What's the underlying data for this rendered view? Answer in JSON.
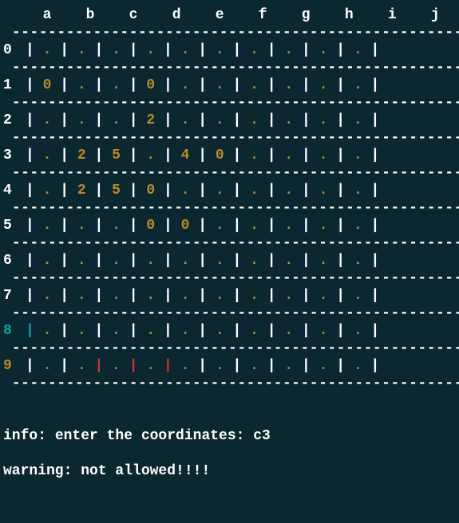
{
  "grid": {
    "col_labels": [
      "a",
      "b",
      "c",
      "d",
      "e",
      "f",
      "g",
      "h",
      "i",
      "j"
    ],
    "row_labels": [
      "0",
      "1",
      "2",
      "3",
      "4",
      "5",
      "6",
      "7",
      "8",
      "9"
    ],
    "cells": [
      [
        ".",
        ".",
        ".",
        ".",
        ".",
        ".",
        ".",
        ".",
        ".",
        "."
      ],
      [
        "0",
        ".",
        ".",
        "0",
        ".",
        ".",
        ".",
        ".",
        ".",
        "."
      ],
      [
        ".",
        ".",
        ".",
        "2",
        ".",
        ".",
        ".",
        ".",
        ".",
        "."
      ],
      [
        ".",
        "2",
        "5",
        ".",
        "4",
        "0",
        ".",
        ".",
        ".",
        "."
      ],
      [
        ".",
        "2",
        "5",
        "0",
        ".",
        ".",
        ".",
        ".",
        ".",
        "."
      ],
      [
        ".",
        ".",
        ".",
        "0",
        "0",
        ".",
        ".",
        ".",
        ".",
        "."
      ],
      [
        ".",
        ".",
        ".",
        ".",
        ".",
        ".",
        ".",
        ".",
        ".",
        "."
      ],
      [
        ".",
        ".",
        ".",
        ".",
        ".",
        ".",
        ".",
        ".",
        ".",
        "."
      ],
      [
        ".",
        ".",
        ".",
        ".",
        ".",
        ".",
        ".",
        ".",
        ".",
        "."
      ],
      [
        ".",
        ".",
        ".",
        ".",
        ".",
        ".",
        ".",
        ".",
        ".",
        "."
      ]
    ],
    "special_rows": {
      "8": "teal-first-pipe",
      "9": "red-inner-pipes"
    },
    "divider": "----------------------------------------------------"
  },
  "messages": {
    "info_label": "info: ",
    "info_text": "enter the coordinates: c3",
    "warning_label": "warning: ",
    "warning_text": "not allowed!!!!"
  }
}
